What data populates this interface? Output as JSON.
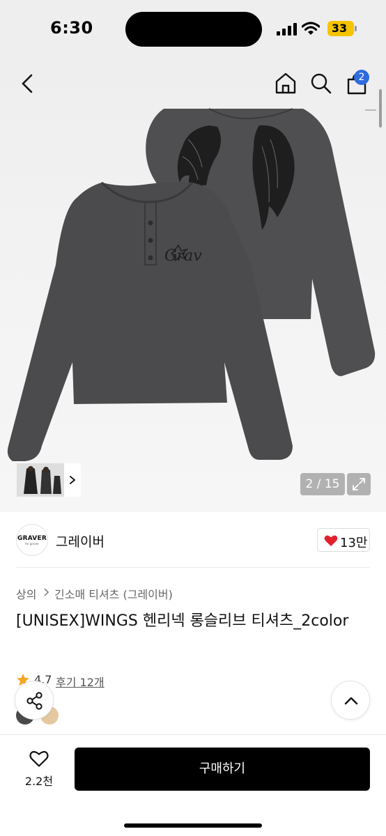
{
  "status_bar": {
    "time": "6:30",
    "battery": "33"
  },
  "nav": {
    "cart_count": "2"
  },
  "gallery": {
    "counter": "2 / 15"
  },
  "brand": {
    "logo_text": "GRAVER",
    "logo_subtext": "for graver",
    "name": "그레이버",
    "likes": "13만"
  },
  "breadcrumb": {
    "level1": "상의",
    "level2": "긴소매 티셔츠 (그레이버)"
  },
  "product": {
    "title": "[UNISEX]WINGS 헨리넥 롱슬리브 티셔츠_2color",
    "rating": "4.7",
    "reviews": "후기 12개",
    "print_text": "Grav",
    "swatches": [
      "#4a4a4a",
      "#e6c8a0"
    ]
  },
  "bottom": {
    "wish_count": "2.2천",
    "buy_label": "구매하기"
  },
  "colors": {
    "accent": "#2f6be0",
    "heart": "#e0222e",
    "star": "#f5a623",
    "shirt": "#4b4b4d"
  }
}
